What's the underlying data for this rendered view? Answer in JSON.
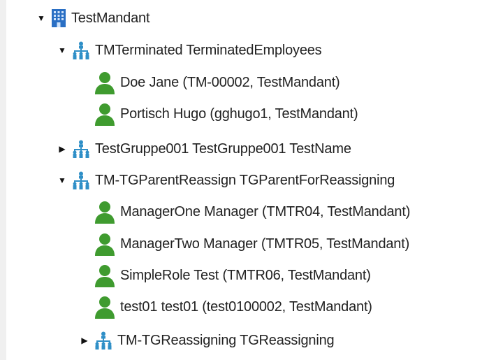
{
  "tree": {
    "root": {
      "label": "TestMandant",
      "expanded": true,
      "toggle_expanded": "▼",
      "toggle_collapsed": "▶",
      "icon": "building-icon",
      "children": [
        {
          "label": "TMTerminated TerminatedEmployees",
          "expanded": true,
          "icon": "org-chart-icon",
          "children": [
            {
              "label": "Doe Jane (TM-00002, TestMandant)",
              "icon": "user-icon"
            },
            {
              "label": "Portisch Hugo (gghugo1, TestMandant)",
              "icon": "user-icon"
            }
          ]
        },
        {
          "label": "TestGruppe001 TestGruppe001 TestName",
          "expanded": false,
          "icon": "org-chart-icon",
          "children": []
        },
        {
          "label": "TM-TGParentReassign TGParentForReassigning",
          "expanded": true,
          "icon": "org-chart-icon",
          "children": [
            {
              "label": "ManagerOne Manager (TMTR04, TestMandant)",
              "icon": "user-icon"
            },
            {
              "label": "ManagerTwo Manager (TMTR05, TestMandant)",
              "icon": "user-icon"
            },
            {
              "label": "SimpleRole Test (TMTR06, TestMandant)",
              "icon": "user-icon"
            },
            {
              "label": "test01 test01 (test0100002, TestMandant)",
              "icon": "user-icon"
            },
            {
              "label": "TM-TGReassigning TGReassigning",
              "expanded": false,
              "icon": "org-chart-icon",
              "children": []
            }
          ]
        }
      ]
    }
  },
  "colors": {
    "user_green": "#3f9b2f",
    "org_blue": "#2f8fc7",
    "building_blue": "#2a6fc4",
    "text": "#222222"
  }
}
